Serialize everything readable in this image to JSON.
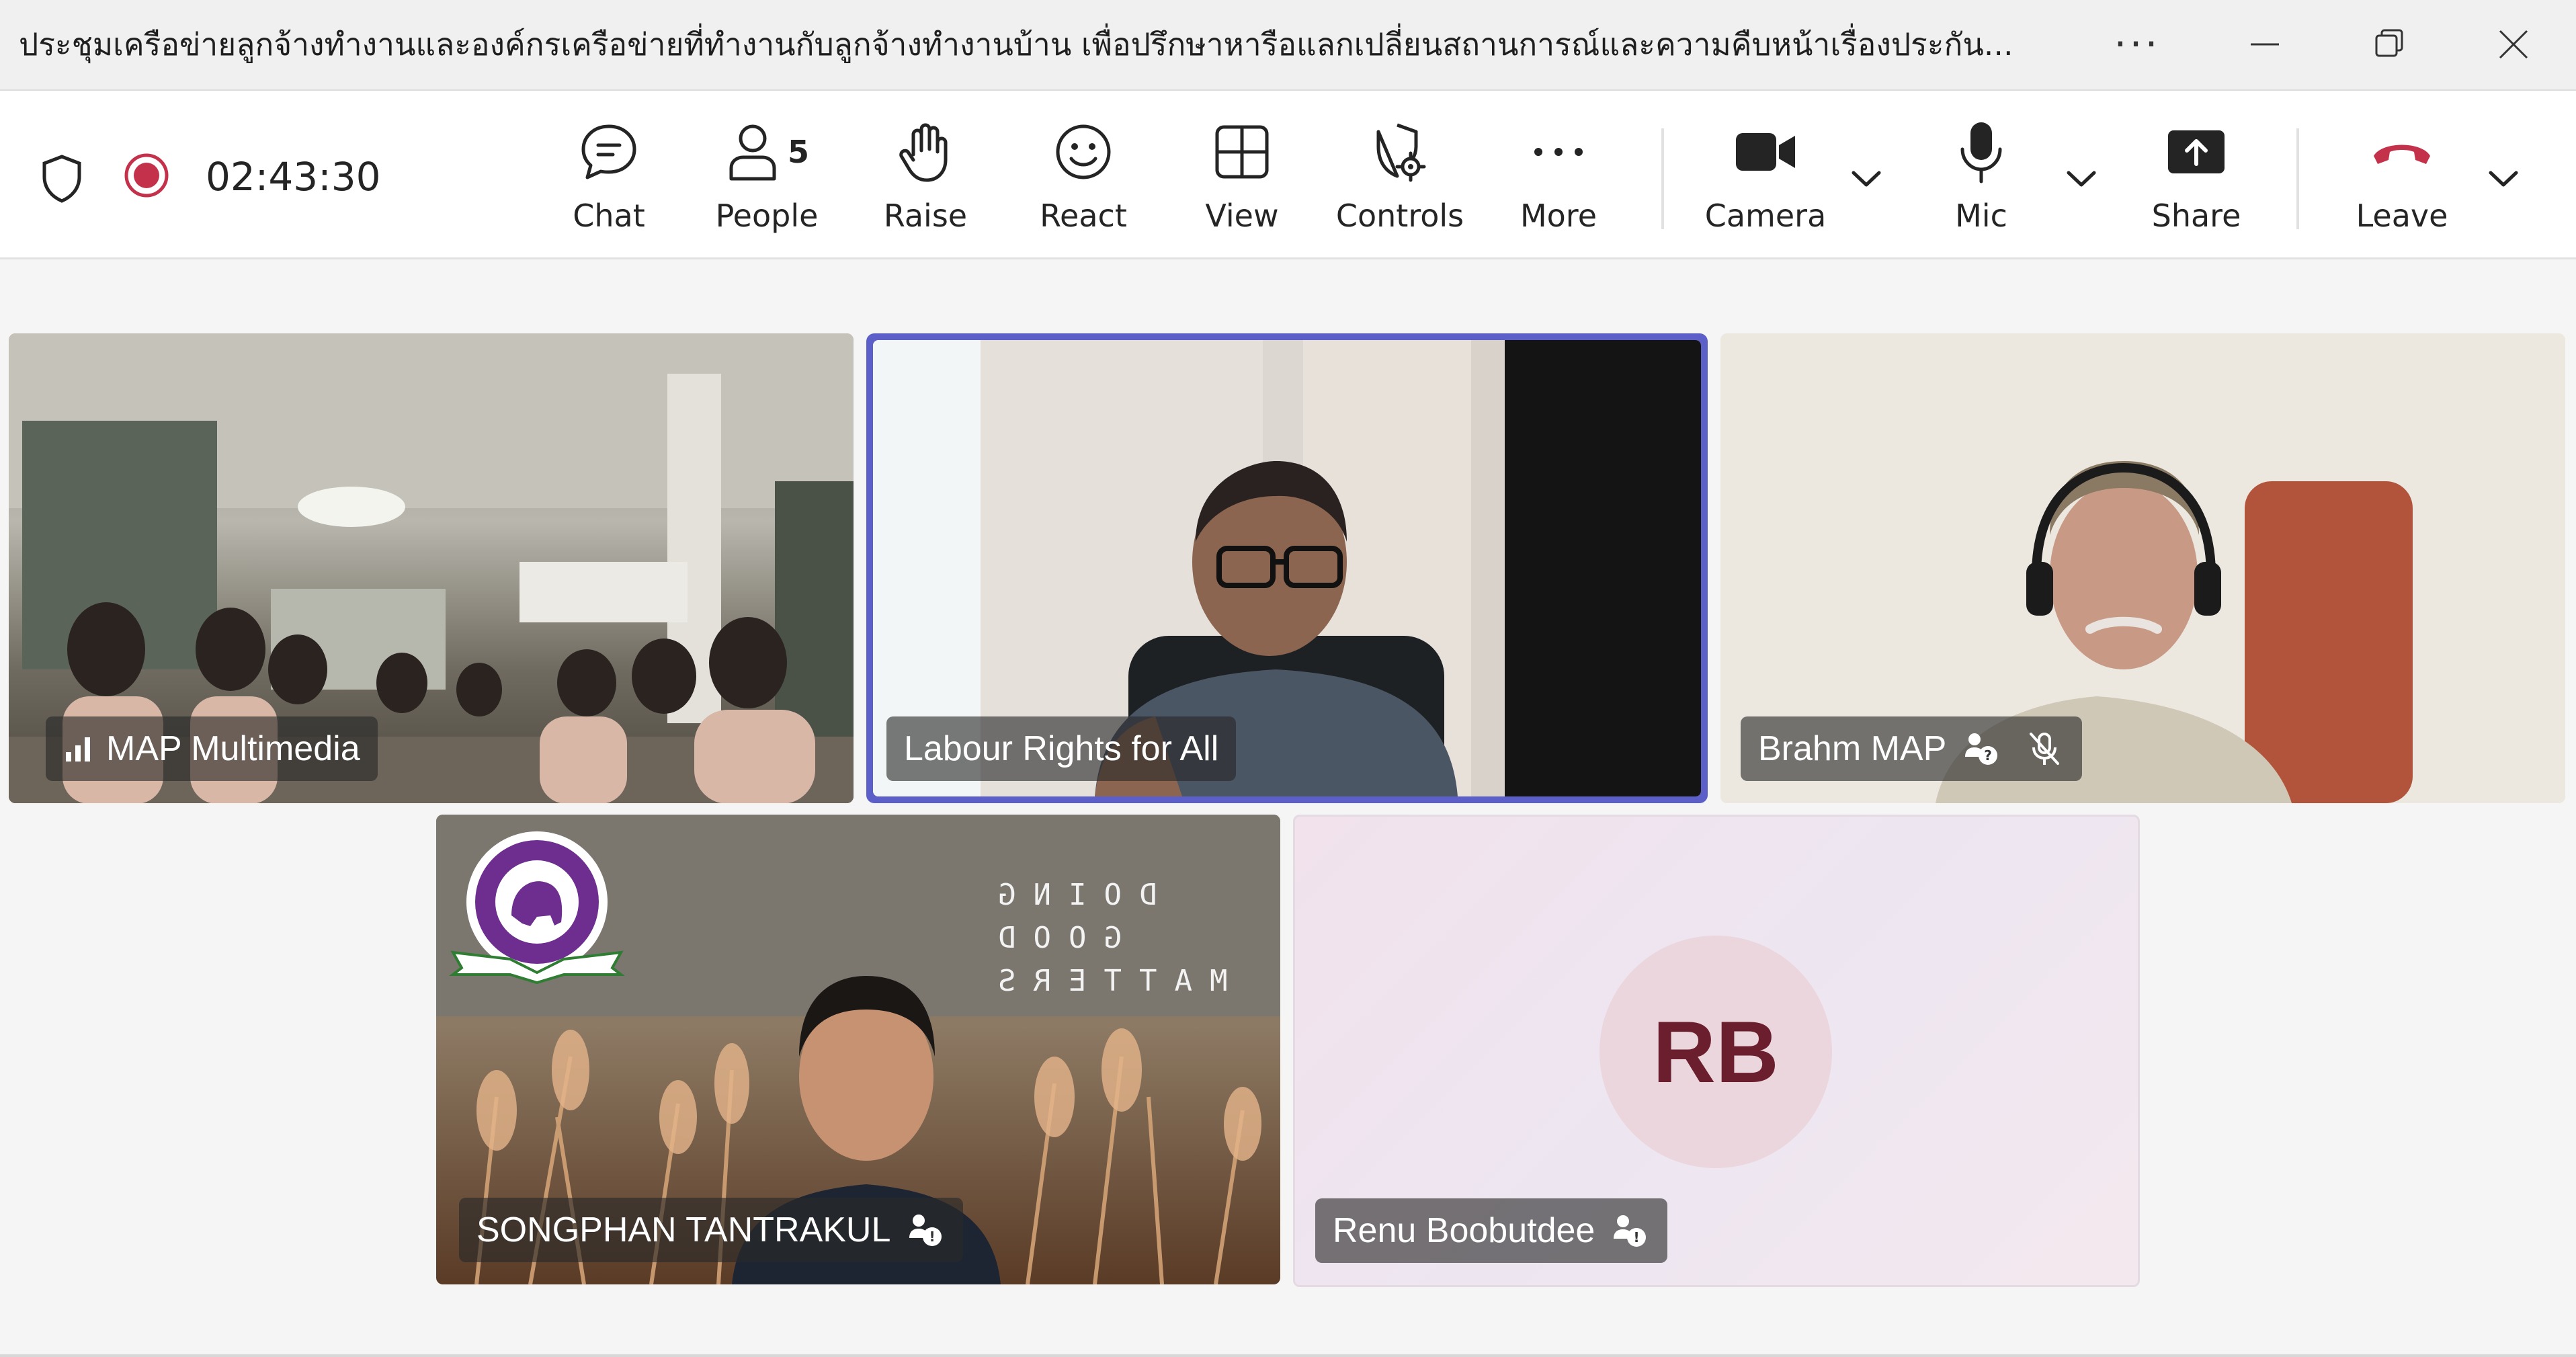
{
  "window": {
    "title": "ประชุมเครือข่ายลูกจ้างทำงานและองค์กรเครือข่ายที่ทำงานกับลูกจ้างทำงานบ้าน เพื่อปรึกษาหารือแลกเปลี่ยนสถานการณ์และความคืบหน้าเรื่องประกัน...",
    "more_glyph": "···"
  },
  "call": {
    "timer": "02:43:30",
    "recording": true
  },
  "toolbar": {
    "chat_label": "Chat",
    "people_label": "People",
    "people_count": "5",
    "raise_label": "Raise",
    "react_label": "React",
    "view_label": "View",
    "controls_label": "Controls",
    "more_label": "More",
    "camera_label": "Camera",
    "mic_label": "Mic",
    "share_label": "Share",
    "leave_label": "Leave"
  },
  "participants": [
    {
      "name": "MAP Multimedia",
      "icons": [
        "signal-icon"
      ]
    },
    {
      "name": "Labour Rights for All",
      "icons": [],
      "active_speaker": true
    },
    {
      "name": "Brahm MAP",
      "icons": [
        "unverified-icon",
        "mic-off-icon"
      ]
    },
    {
      "name": "SONGPHAN TANTRAKUL",
      "icons": [
        "unverified-icon"
      ]
    },
    {
      "name": "Renu Boobutdee",
      "initials": "RB",
      "icons": [
        "unverified-icon"
      ]
    }
  ],
  "background_text": [
    "DOING",
    "GOOD",
    "MATTERS"
  ],
  "colors": {
    "accent": "#5b5fc7",
    "record_red": "#c4314b",
    "leave_red": "#c4314b",
    "avatar_bg": "#ead6dc",
    "avatar_text": "#6b1f2e"
  }
}
